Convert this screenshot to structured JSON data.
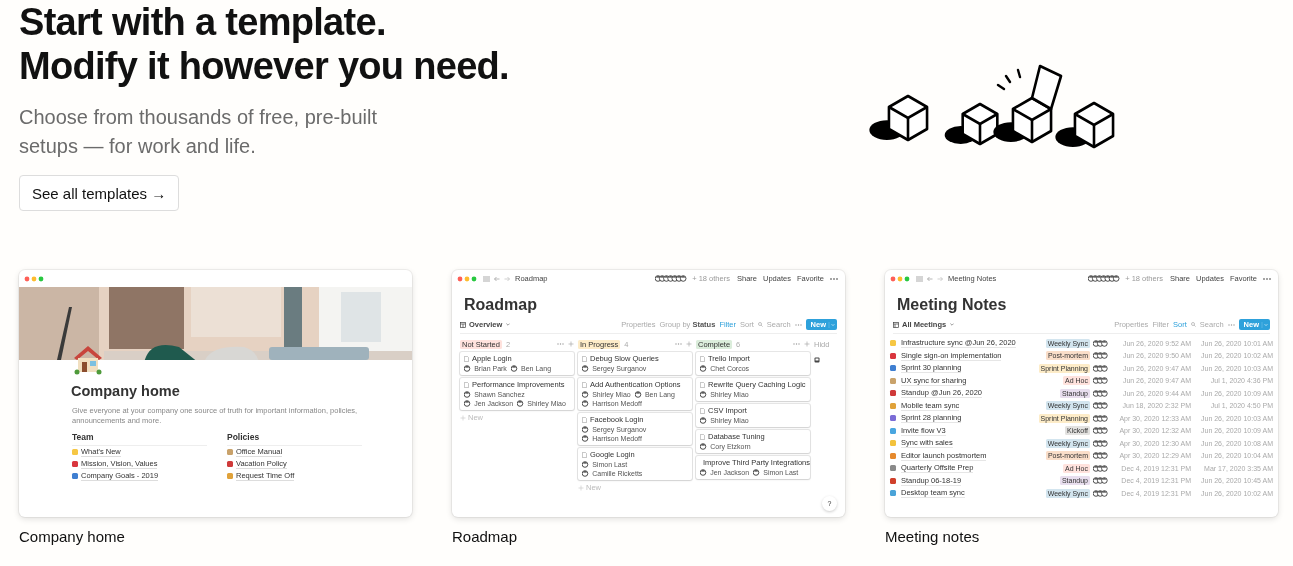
{
  "hero": {
    "heading_lines": [
      "Start with a template.",
      "Modify it however you need."
    ],
    "subtitle_lines": [
      "Choose from thousands of free, pre-built",
      "setups — for work and life."
    ],
    "button": "See all templates →"
  },
  "templates": [
    {
      "kind": "page",
      "caption": "Company home",
      "title": "Company home",
      "description": "Give everyone at your company one source of truth for important information, policies, announcements and more.",
      "sections": [
        {
          "heading": "Team",
          "items": [
            "What's New",
            "Mission, Vision, Values",
            "Company Goals - 2019"
          ]
        },
        {
          "heading": "Policies",
          "items": [
            "Office Manual",
            "Vacation Policy",
            "Request Time Off"
          ]
        }
      ]
    },
    {
      "kind": "board",
      "caption": "Roadmap",
      "topbar": {
        "breadcrumb": "Roadmap",
        "others": "+ 18 others",
        "actions": [
          "Share",
          "Updates",
          "Favorite"
        ]
      },
      "title": "Roadmap",
      "view": "Overview",
      "toolbar": {
        "items": [
          {
            "label": "Properties",
            "active": false
          },
          {
            "label": "Group by **Status**",
            "active": false
          },
          {
            "label": "Filter",
            "active": true
          },
          {
            "label": "Sort",
            "active": false
          }
        ],
        "search": "Search",
        "new_button": "New"
      },
      "columns": [
        {
          "status": "Not Started",
          "count": "2",
          "color": "#ffe2dd",
          "add_label": "New",
          "cards": [
            {
              "title": "Apple Login",
              "people": [
                "Brian Park",
                "Ben Lang"
              ]
            },
            {
              "title": "Performance Improvements",
              "people": [
                "Shawn Sanchez",
                "Jen Jackson",
                "Shirley Miao"
              ]
            }
          ]
        },
        {
          "status": "In Progress",
          "count": "4",
          "color": "#fdecc8",
          "add_label": "New",
          "cards": [
            {
              "title": "Debug Slow Queries",
              "people": [
                "Sergey Surganov"
              ]
            },
            {
              "title": "Add Authentication Options",
              "people": [
                "Shirley Miao",
                "Ben Lang",
                "Harrison Medoff"
              ]
            },
            {
              "title": "Facebook Login",
              "people": [
                "Sergey Surganov",
                "Harrison Medoff"
              ]
            },
            {
              "title": "Google Login",
              "people": [
                "Simon Last",
                "Camille Ricketts"
              ]
            }
          ]
        },
        {
          "status": "Complete",
          "count": "6",
          "color": "#dbeddb",
          "cards": [
            {
              "title": "Trello Import",
              "people": [
                "Chet Corcos"
              ]
            },
            {
              "title": "Rewrite Query Caching Logic",
              "people": [
                "Shirley Miao"
              ]
            },
            {
              "title": "CSV Import",
              "people": [
                "Shirley Miao"
              ]
            },
            {
              "title": "Database Tuning",
              "people": [
                "Cory Etzkorn"
              ]
            },
            {
              "title": "Improve Third Party Integrations",
              "people": [
                "Jen Jackson",
                "Simon Last"
              ]
            }
          ]
        }
      ],
      "hidden_label": "Hidd",
      "help": "?"
    },
    {
      "kind": "table",
      "caption": "Meeting notes",
      "topbar": {
        "breadcrumb": "Meeting Notes",
        "others": "+ 18 others",
        "actions": [
          "Share",
          "Updates",
          "Favorite"
        ]
      },
      "title": "Meeting Notes",
      "view": "All Meetings",
      "toolbar": {
        "items": [
          {
            "label": "Properties",
            "active": false
          },
          {
            "label": "Filter",
            "active": false
          },
          {
            "label": "Sort",
            "active": true
          }
        ],
        "search": "Search",
        "new_button": "New"
      },
      "rows": [
        {
          "name": "Infrastructure sync @Jun 26, 2020",
          "tag": {
            "label": "Weekly Sync",
            "color": "#d3e5ef"
          },
          "created": "Jun 26, 2020 9:52 AM",
          "edited": "Jun 26, 2020 10:01 AM"
        },
        {
          "name": "Single sign-on implementation",
          "tag": {
            "label": "Post-mortem",
            "color": "#fadec9"
          },
          "created": "Jun 26, 2020 9:50 AM",
          "edited": "Jun 26, 2020 10:02 AM"
        },
        {
          "name": "Sprint 30 planning",
          "tag": {
            "label": "Sprint Planning",
            "color": "#fdecc8"
          },
          "created": "Jun 26, 2020 9:47 AM",
          "edited": "Jun 26, 2020 10:03 AM"
        },
        {
          "name": "UX sync for sharing",
          "tag": {
            "label": "Ad Hoc",
            "color": "#ffe2dd"
          },
          "created": "Jun 26, 2020 9:47 AM",
          "edited": "Jul 1, 2020 4:36 PM"
        },
        {
          "name": "Standup @Jun 26, 2020",
          "tag": {
            "label": "Standup",
            "color": "#e8deee"
          },
          "created": "Jun 26, 2020 9:44 AM",
          "edited": "Jun 26, 2020 10:09 AM"
        },
        {
          "name": "Mobile team sync",
          "tag": {
            "label": "Weekly Sync",
            "color": "#d3e5ef"
          },
          "created": "Jun 18, 2020 2:32 PM",
          "edited": "Jul 1, 2020 4:50 PM"
        },
        {
          "name": "Sprint 28 planning",
          "tag": {
            "label": "Sprint Planning",
            "color": "#fdecc8"
          },
          "created": "Apr 30, 2020 12:33 AM",
          "edited": "Jun 26, 2020 10:03 AM"
        },
        {
          "name": "Invite flow V3",
          "tag": {
            "label": "Kickoff",
            "color": "#e3e2e0"
          },
          "created": "Apr 30, 2020 12:32 AM",
          "edited": "Jun 26, 2020 10:09 AM"
        },
        {
          "name": "Sync with sales",
          "tag": {
            "label": "Weekly Sync",
            "color": "#d3e5ef"
          },
          "created": "Apr 30, 2020 12:30 AM",
          "edited": "Jun 26, 2020 10:08 AM"
        },
        {
          "name": "Editor launch postmortem",
          "tag": {
            "label": "Post-mortem",
            "color": "#fadec9"
          },
          "created": "Apr 30, 2020 12:29 AM",
          "edited": "Jun 26, 2020 10:04 AM"
        },
        {
          "name": "Quarterly Offsite Prep",
          "tag": {
            "label": "Ad Hoc",
            "color": "#ffe2dd"
          },
          "created": "Dec 4, 2019 12:31 PM",
          "edited": "Mar 17, 2020 3:35 AM"
        },
        {
          "name": "Standup 06-18-19",
          "tag": {
            "label": "Standup",
            "color": "#e8deee"
          },
          "created": "Dec 4, 2019 12:31 PM",
          "edited": "Jun 26, 2020 10:45 AM"
        },
        {
          "name": "Desktop team sync",
          "tag": {
            "label": "Weekly Sync",
            "color": "#d3e5ef"
          },
          "created": "Dec 4, 2019 12:31 PM",
          "edited": "Jun 26, 2020 10:02 AM"
        }
      ]
    }
  ]
}
